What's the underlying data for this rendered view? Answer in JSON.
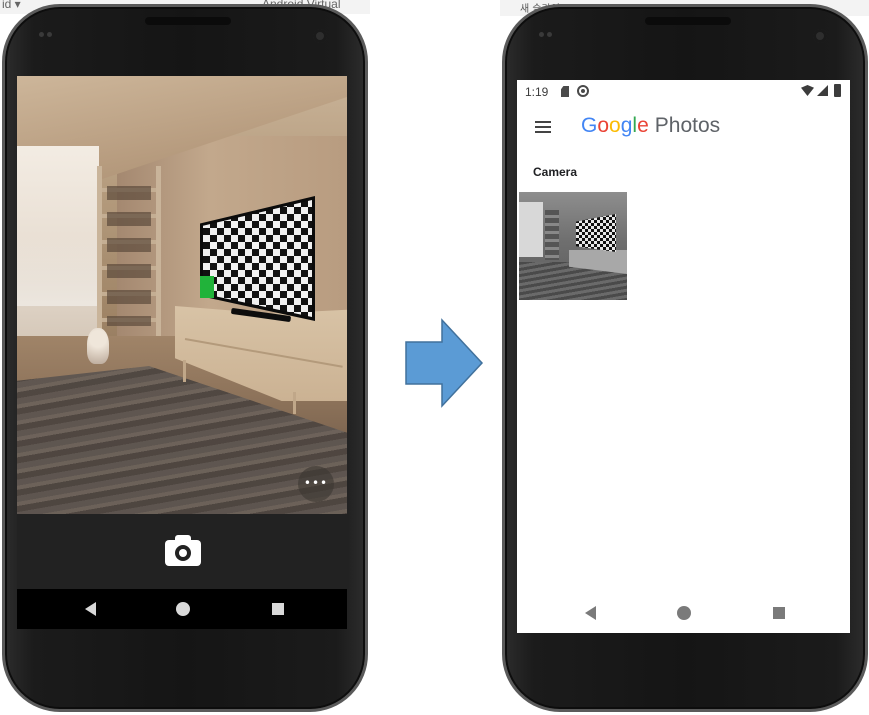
{
  "background": {
    "left_window_text_a": "id  ▾",
    "left_window_text_b": "Android Virtual",
    "right_window_text": "새 슬라이드  ≡  ⊞  ⊡"
  },
  "camera_app": {
    "more_button_label": "•••",
    "shutter_icon": "camera-icon",
    "nav": [
      "back-icon",
      "home-icon",
      "recents-icon"
    ]
  },
  "arrow": {
    "color": "#5b9bd5",
    "direction": "right"
  },
  "photos_app": {
    "status": {
      "time": "1:19",
      "icons": [
        "sd-card-icon",
        "sync-icon",
        "wifi-icon",
        "signal-icon",
        "battery-icon"
      ]
    },
    "logo": {
      "letters": [
        "G",
        "o",
        "o",
        "g",
        "l",
        "e"
      ],
      "product": "Photos"
    },
    "section_title": "Camera",
    "thumbnails": 1,
    "nav": [
      "back-icon",
      "home-icon",
      "recents-icon"
    ]
  },
  "colors": {
    "google_blue": "#4285F4",
    "google_red": "#EA4335",
    "google_yellow": "#FBBC05",
    "google_green": "#34A853",
    "green_marker": "#21b33a"
  }
}
